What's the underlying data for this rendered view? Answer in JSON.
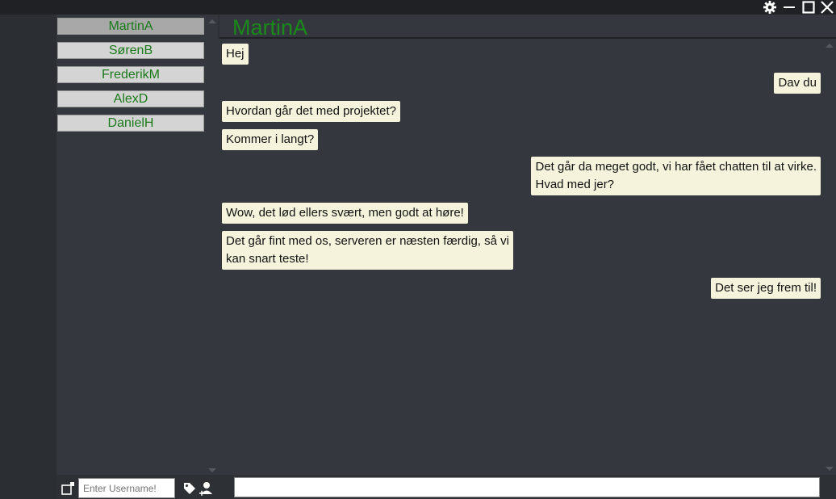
{
  "window": {
    "settings_icon": "gear-icon",
    "minimize_icon": "minimize-icon",
    "maximize_icon": "maximize-icon",
    "close_icon": "close-icon"
  },
  "contacts": [
    {
      "name": "MartinA",
      "active": true
    },
    {
      "name": "SørenB",
      "active": false
    },
    {
      "name": "FrederikM",
      "active": false
    },
    {
      "name": "AlexD",
      "active": false
    },
    {
      "name": "DanielH",
      "active": false
    }
  ],
  "chat": {
    "title": "MartinA",
    "title_color": "#1a8a1a",
    "messages": [
      {
        "side": "left",
        "lines": [
          "Hej"
        ]
      },
      {
        "side": "right",
        "lines": [
          "Dav du"
        ]
      },
      {
        "side": "left",
        "lines": [
          "Hvordan går det med projektet?"
        ]
      },
      {
        "side": "left",
        "lines": [
          "Kommer i langt?"
        ]
      },
      {
        "side": "right",
        "lines": [
          "Det går da meget godt, vi har fået chatten til at virke.",
          "Hvad med jer?"
        ]
      },
      {
        "side": "left",
        "lines": [
          "Wow, det lød ellers svært, men godt at høre!"
        ]
      },
      {
        "side": "left",
        "lines": [
          "Det går fint med os, serveren er næsten færdig, så vi",
          "kan snart teste!"
        ]
      },
      {
        "side": "right",
        "lines": [
          "Det ser jeg frem til!"
        ]
      }
    ]
  },
  "bottom": {
    "username_placeholder": "Enter Username!",
    "message_value": "",
    "new_chat_icon": "new-window-icon",
    "tag_icon": "tag-icon",
    "add_user_icon": "add-user-icon"
  },
  "colors": {
    "contact_text": "#1a7a1a",
    "bubble_bg": "#f5f3dc"
  }
}
